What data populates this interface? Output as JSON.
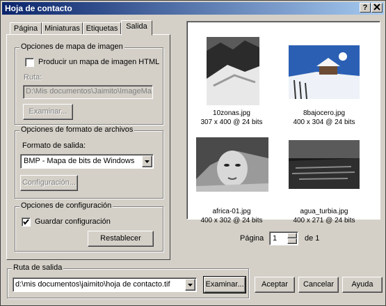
{
  "window": {
    "title": "Hoja de contacto",
    "help_btn": "?",
    "close_btn": "x"
  },
  "tabs": [
    "Página",
    "Miniaturas",
    "Etiquetas",
    "Salida"
  ],
  "imagemap": {
    "group_title": "Opciones de mapa de imagen",
    "checkbox_label": "Producir un mapa de imagen HTML",
    "checked": false,
    "route_label": "Ruta:",
    "route_value": "D:\\Mis documentos\\Jaimito\\ImageMa",
    "browse_btn": "Examinar..."
  },
  "format": {
    "group_title": "Opciones de formato de archivos",
    "output_label": "Formato de salida:",
    "selected": "BMP - Mapa de bits de Windows",
    "config_btn": "Configuración..."
  },
  "settings": {
    "group_title": "Opciones de configuración",
    "save_label": "Guardar configuración",
    "checked": true,
    "reset_btn": "Restablecer"
  },
  "preview": {
    "items": [
      {
        "name": "10zonas.jpg",
        "info": "307 x 400 @ 24 bits"
      },
      {
        "name": "8bajocero.jpg",
        "info": "400 x 304 @ 24 bits"
      },
      {
        "name": "africa-01.jpg",
        "info": "400 x 302 @ 24 bits"
      },
      {
        "name": "agua_turbia.jpg",
        "info": "400 x 271 @ 24 bits"
      }
    ]
  },
  "paging": {
    "label": "Página",
    "value": "1",
    "of": "de 1"
  },
  "output": {
    "group_title": "Ruta de salida",
    "path": "d:\\mis documentos\\jaimito\\hoja de contacto.tif",
    "browse_btn": "Examinar..."
  },
  "footer": {
    "accept": "Aceptar",
    "cancel": "Cancelar",
    "help": "Ayuda"
  }
}
